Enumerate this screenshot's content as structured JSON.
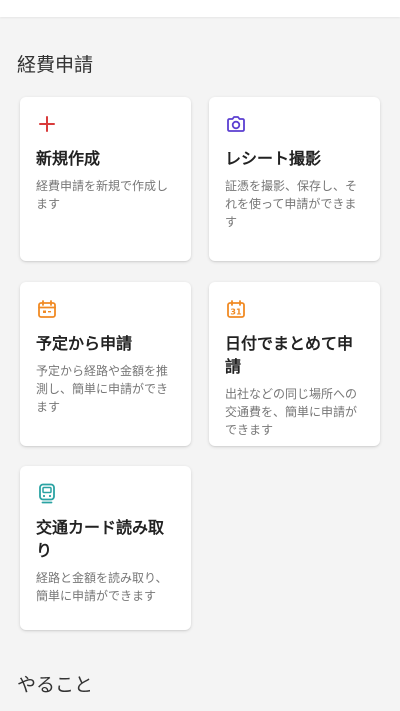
{
  "sections": {
    "expense_title": "経費申請",
    "todo_title": "やること"
  },
  "cards": [
    {
      "title": "新規作成",
      "description": "経費申請を新規で作成します",
      "icon": "plus-icon",
      "icon_color": "#d93b3b"
    },
    {
      "title": "レシート撮影",
      "description": "証憑を撮影、保存し、それを使って申請ができます",
      "icon": "camera-icon",
      "icon_color": "#5b3fd1"
    },
    {
      "title": "予定から申請",
      "description": "予定から経路や金額を推測し、簡単に申請ができます",
      "icon": "calendar-icon",
      "icon_color": "#f08a24"
    },
    {
      "title": "日付でまとめて申請",
      "description": "出社などの同じ場所への交通費を、簡単に申請ができます",
      "icon": "calendar-31-icon",
      "icon_color": "#f08a24",
      "icon_text": "31"
    },
    {
      "title": "交通カード読み取り",
      "description": "経路と金額を読み取り、簡単に申請ができます",
      "icon": "train-card-icon",
      "icon_color": "#2aa3a3"
    }
  ]
}
